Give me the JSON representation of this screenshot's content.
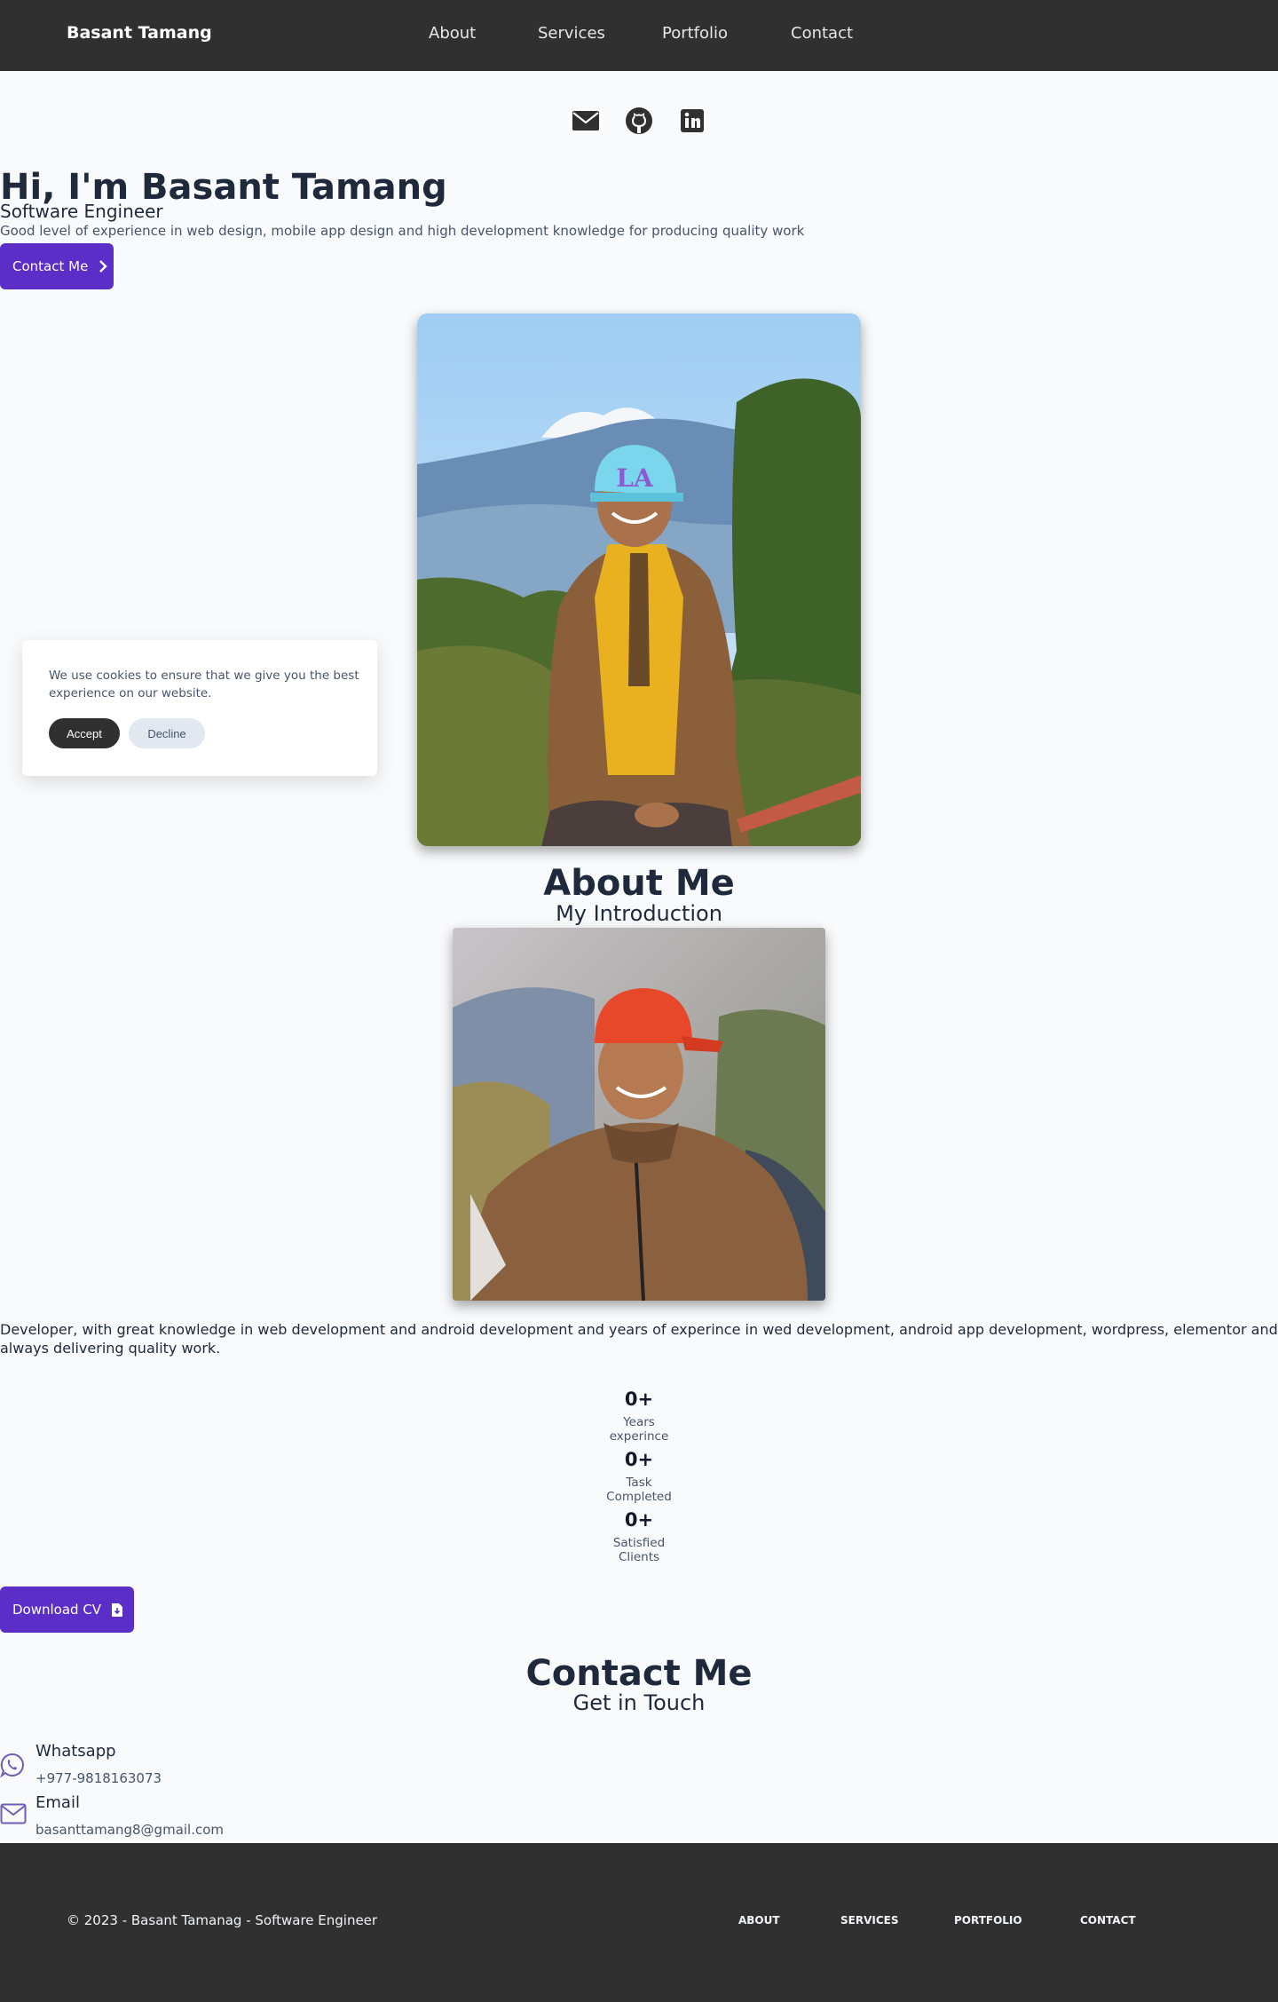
{
  "nav": {
    "brand": "Basant Tamang",
    "links": [
      "About",
      "Services",
      "Portfolio",
      "Contact"
    ]
  },
  "social_icons": [
    "envelope-icon",
    "github-icon",
    "linkedin-icon"
  ],
  "hero": {
    "title": "Hi, I'm Basant Tamang",
    "subtitle": "Software Engineer",
    "description": "Good level of experience in web design, mobile app design and high development knowledge for producing quality work",
    "cta_label": "Contact Me"
  },
  "cookie": {
    "text": "We use cookies to ensure that we give you the best experience on our website.",
    "accept": "Accept",
    "decline": "Decline"
  },
  "about": {
    "title": "About Me",
    "subtitle": "My Introduction",
    "description": "Developer, with great knowledge in web development and android development and years of experince in wed development, android app development, wordpress, elementor and always delivering quality work.",
    "stats": [
      {
        "value": "0+",
        "label_line1": "Years",
        "label_line2": "experince"
      },
      {
        "value": "0+",
        "label_line1": "Task",
        "label_line2": "Completed"
      },
      {
        "value": "0+",
        "label_line1": "Satisfied",
        "label_line2": "Clients"
      }
    ],
    "cv_label": "Download CV"
  },
  "contact": {
    "title": "Contact Me",
    "subtitle": "Get in Touch",
    "items": [
      {
        "title": "Whatsapp",
        "value": "+977-9818163073",
        "icon": "whatsapp-icon"
      },
      {
        "title": "Email",
        "value": "basanttamang8@gmail.com",
        "icon": "envelope-icon"
      }
    ]
  },
  "footer": {
    "copyright": "© 2023 - Basant Tamanag - Software Engineer",
    "links": [
      "ABOUT",
      "SERVICES",
      "PORTFOLIO",
      "CONTACT"
    ]
  },
  "colors": {
    "nav_bg": "#303030",
    "accent": "#5b2ec8",
    "page_bg": "#f8fafc",
    "heading": "#1e293b",
    "contact_icon": "#6d5fb8"
  }
}
